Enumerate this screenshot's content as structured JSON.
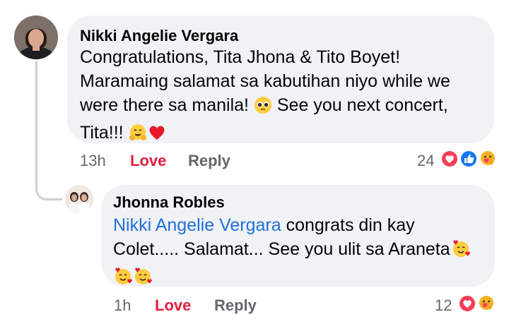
{
  "comment": {
    "author": "Nikki Angelie Vergara",
    "lines": [
      "Congratulations, Tita Jhona & Tito Boyet!",
      "Maramaing salamat sa kabutihan niyo while we",
      "were there sa manila!",
      "See you next concert,",
      "Tita!!!"
    ],
    "time": "13h",
    "like_label": "Love",
    "reply_label": "Reply",
    "reaction_count": "24",
    "reactions": [
      "love",
      "like",
      "care"
    ]
  },
  "reply": {
    "author": "Jhonna Robles",
    "mention": "Nikki Angelie Vergara",
    "text_after_mention": " congrats din kay",
    "line2": "Colet..... Salamat... See you ulit sa Araneta",
    "time": "1h",
    "like_label": "Love",
    "reply_label": "Reply",
    "reaction_count": "12",
    "reactions": [
      "love",
      "care"
    ]
  },
  "colors": {
    "bubble": "#f0f2f5",
    "love": "#e41e3f",
    "mention": "#216fdb",
    "meta": "#65676b",
    "like": "#1877f2"
  }
}
